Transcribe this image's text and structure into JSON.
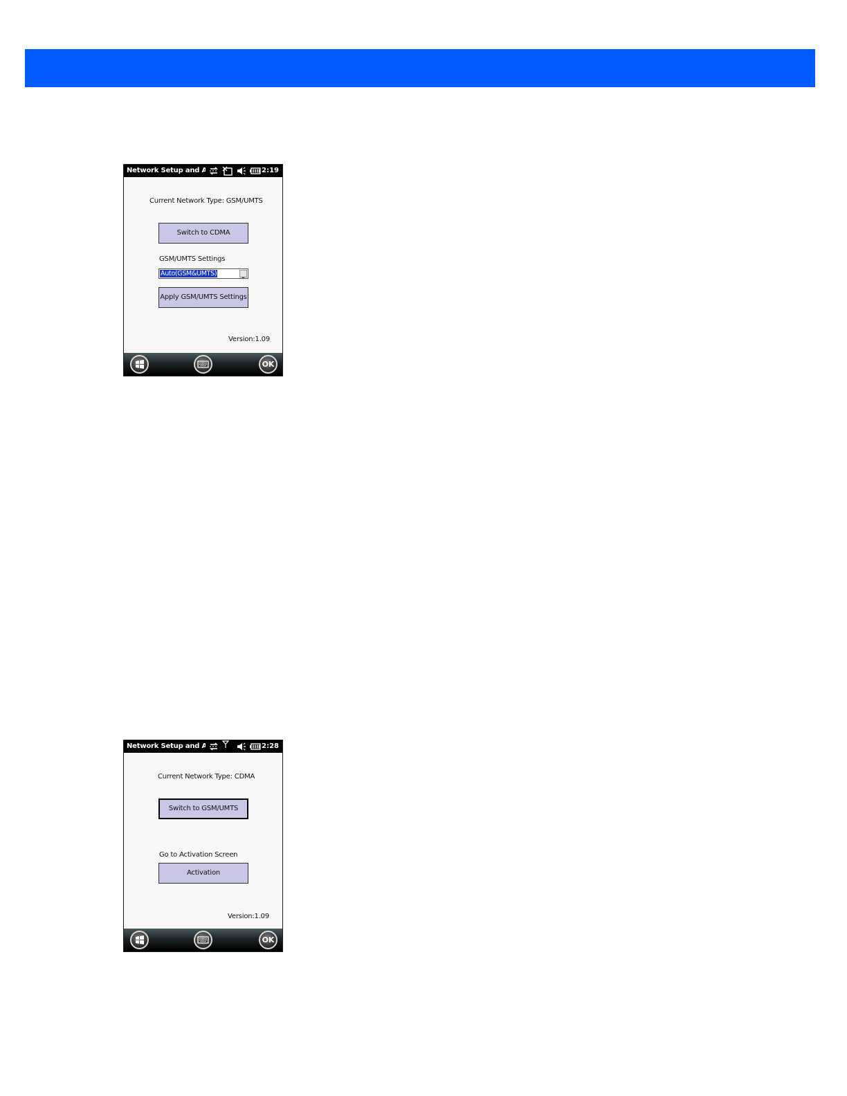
{
  "screens": [
    {
      "status_title": "Network Setup and Act",
      "clock": "2:19",
      "network_type": "Current Network Type: GSM/UMTS",
      "switch_button": "Switch to CDMA",
      "settings_label": "GSM/UMTS Settings",
      "dropdown_value": "Auto(GSM&UMTS)",
      "apply_button": "Apply GSM/UMTS Settings",
      "version": "Version:1.09",
      "ok_label": "OK"
    },
    {
      "status_title": "Network Setup and Act",
      "clock": "2:28",
      "network_type": "Current Network Type: CDMA",
      "switch_button": "Switch to GSM/UMTS",
      "activation_label": "Go to Activation Screen",
      "activation_button": "Activation",
      "version": "Version:1.09",
      "ok_label": "OK"
    }
  ],
  "colors": {
    "banner": "#005cff",
    "button_fill": "#c8c8e6",
    "selection": "#1638c8"
  },
  "icons": [
    "sync-arrows-icon",
    "no-sim-icon",
    "antenna-icon",
    "speaker-icon",
    "battery-icon",
    "windows-start-icon",
    "keyboard-icon"
  ]
}
